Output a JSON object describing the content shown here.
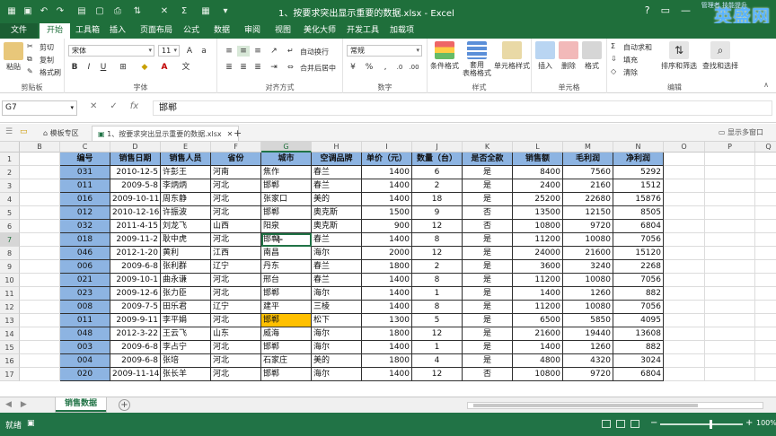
{
  "window": {
    "title": "1、按要求突出显示重要的数据.xlsx - Excel",
    "logo": "英盛网",
    "logo_sub": "管理者 技能提升"
  },
  "tabs": [
    {
      "label": "文件"
    },
    {
      "label": "开始"
    },
    {
      "label": "工具箱"
    },
    {
      "label": "插入"
    },
    {
      "label": "页面布局"
    },
    {
      "label": "公式"
    },
    {
      "label": "数据"
    },
    {
      "label": "审阅"
    },
    {
      "label": "视图"
    },
    {
      "label": "美化大师"
    },
    {
      "label": "开发工具"
    },
    {
      "label": "加载项"
    }
  ],
  "ribbon": {
    "clipboard": {
      "label": "剪贴板",
      "paste": "粘贴",
      "cut": "剪切",
      "copy": "复制",
      "format_painter": "格式刷"
    },
    "font": {
      "label": "字体",
      "name": "宋体",
      "size": "11"
    },
    "align": {
      "label": "对齐方式",
      "wrap": "自动换行",
      "merge": "合并后居中"
    },
    "number": {
      "label": "数字",
      "format": "常规"
    },
    "styles": {
      "label": "样式",
      "cond": "条件格式",
      "table": "套用\n表格格式",
      "cell": "单元格样式"
    },
    "cells": {
      "label": "单元格",
      "insert": "插入",
      "delete": "删除",
      "format": "格式"
    },
    "editing": {
      "label": "编辑",
      "autosum": "自动求和",
      "fill": "填充",
      "clear": "清除",
      "sort": "排序和筛选",
      "find": "查找和选择"
    }
  },
  "formula_bar": {
    "name_box": "G7",
    "fx": "fx",
    "value": "邯郸"
  },
  "workbook_tabs": {
    "template": "模板专区",
    "file": "1、按要求突出显示重要的数据.xlsx",
    "multi": "显示多窗口"
  },
  "sheet": {
    "columns": [
      "B",
      "C",
      "D",
      "E",
      "F",
      "G",
      "H",
      "I",
      "J",
      "K",
      "L",
      "M",
      "N",
      "O",
      "P",
      "Q"
    ],
    "headers": [
      "编号",
      "销售日期",
      "销售人员",
      "省份",
      "城市",
      "空调品牌",
      "单价（元）",
      "数量（台）",
      "是否全款",
      "销售额",
      "毛利润",
      "净利润"
    ],
    "rows": [
      [
        "031",
        "2010-12-5",
        "许彭王",
        "河南",
        "焦作",
        "春兰",
        "1400",
        "6",
        "是",
        "8400",
        "7560",
        "5292"
      ],
      [
        "011",
        "2009-5-8",
        "李炳炳",
        "河北",
        "邯郸",
        "春兰",
        "1400",
        "2",
        "是",
        "2400",
        "2160",
        "1512"
      ],
      [
        "016",
        "2009-10-11",
        "周东静",
        "河北",
        "张家口",
        "美的",
        "1400",
        "18",
        "是",
        "25200",
        "22680",
        "15876"
      ],
      [
        "012",
        "2010-12-16",
        "许振波",
        "河北",
        "邯郸",
        "奥克斯",
        "1500",
        "9",
        "否",
        "13500",
        "12150",
        "8505"
      ],
      [
        "032",
        "2011-4-15",
        "刘龙飞",
        "山西",
        "阳泉",
        "奥克斯",
        "900",
        "12",
        "否",
        "10800",
        "9720",
        "6804"
      ],
      [
        "018",
        "2009-11-2",
        "耿中虎",
        "河北",
        "邯郸",
        "春兰",
        "1400",
        "8",
        "是",
        "11200",
        "10080",
        "7056"
      ],
      [
        "046",
        "2012-1-20",
        "黄利",
        "江西",
        "南昌",
        "海尔",
        "2000",
        "12",
        "是",
        "24000",
        "21600",
        "15120"
      ],
      [
        "006",
        "2009-6-8",
        "张利群",
        "辽宁",
        "丹东",
        "春兰",
        "1800",
        "2",
        "是",
        "3600",
        "3240",
        "2268"
      ],
      [
        "021",
        "2009-10-1",
        "曲永谦",
        "河北",
        "邢台",
        "春兰",
        "1400",
        "8",
        "是",
        "11200",
        "10080",
        "7056"
      ],
      [
        "023",
        "2009-12-6",
        "张力臣",
        "河北",
        "邯郸",
        "海尔",
        "1400",
        "1",
        "是",
        "1400",
        "1260",
        "882"
      ],
      [
        "008",
        "2009-7-5",
        "田乐君",
        "辽宁",
        "建平",
        "三棱",
        "1400",
        "8",
        "是",
        "11200",
        "10080",
        "7056"
      ],
      [
        "011",
        "2009-9-11",
        "李平娟",
        "河北",
        "邯郸",
        "松下",
        "1300",
        "5",
        "是",
        "6500",
        "5850",
        "4095"
      ],
      [
        "048",
        "2012-3-22",
        "王云飞",
        "山东",
        "威海",
        "海尔",
        "1800",
        "12",
        "是",
        "21600",
        "19440",
        "13608"
      ],
      [
        "003",
        "2009-6-8",
        "李占宁",
        "河北",
        "邯郸",
        "海尔",
        "1400",
        "1",
        "是",
        "1400",
        "1260",
        "882"
      ],
      [
        "004",
        "2009-6-8",
        "张培",
        "河北",
        "石家庄",
        "美的",
        "1800",
        "4",
        "是",
        "4800",
        "4320",
        "3024"
      ],
      [
        "020",
        "2009-11-14",
        "张长羊",
        "河北",
        "邯郸",
        "海尔",
        "1400",
        "12",
        "否",
        "10800",
        "9720",
        "6804"
      ]
    ],
    "row_numbers": [
      "1",
      "2",
      "3",
      "4",
      "5",
      "6",
      "7",
      "8",
      "9",
      "10",
      "11",
      "12",
      "13",
      "14",
      "15",
      "16",
      "17"
    ]
  },
  "sheet_tabs": {
    "active": "销售数据"
  },
  "status": {
    "ready": "就绪",
    "zoom": "100%"
  },
  "colors": {
    "excel_green": "#217346",
    "header_blue": "#8db4e2",
    "highlight": "#ffc000"
  }
}
